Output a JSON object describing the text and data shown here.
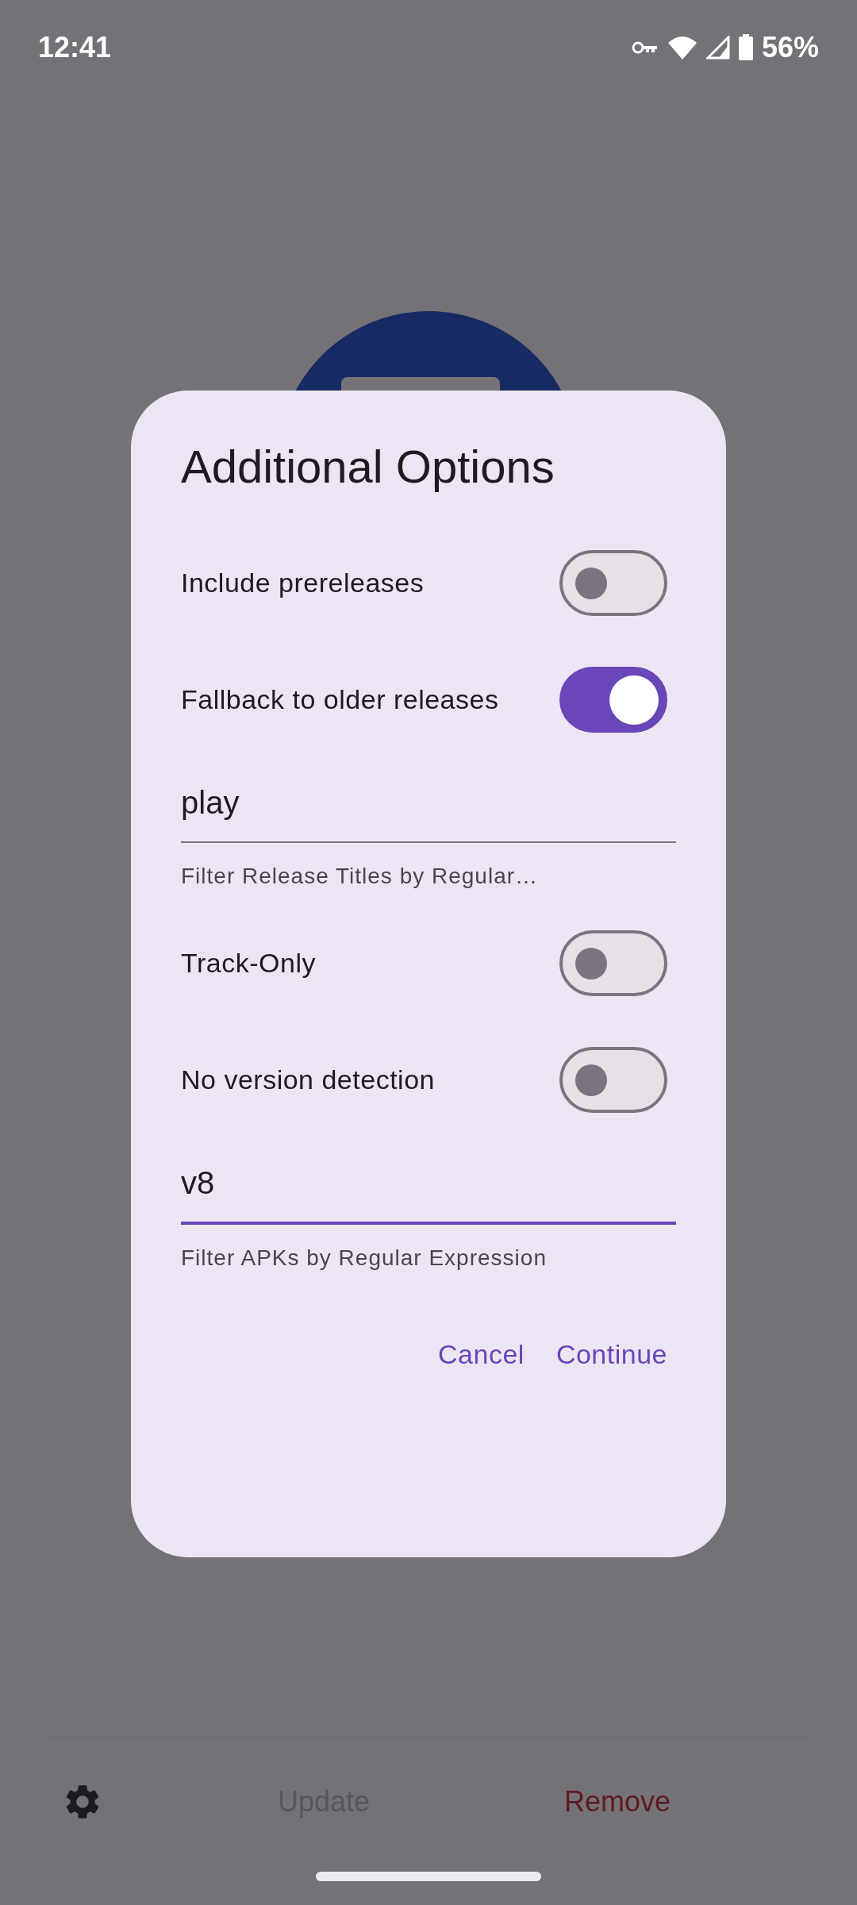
{
  "status_bar": {
    "time": "12:41",
    "battery": "56%"
  },
  "dialog": {
    "title": "Additional Options",
    "items": [
      {
        "kind": "switch",
        "label": "Include prereleases",
        "on": false
      },
      {
        "kind": "switch",
        "label": "Fallback to older releases",
        "on": true
      },
      {
        "kind": "field",
        "value": "play",
        "helper": "Filter Release Titles by Regular…",
        "focused": false
      },
      {
        "kind": "switch",
        "label": "Track-Only",
        "on": false
      },
      {
        "kind": "switch",
        "label": "No version detection",
        "on": false
      },
      {
        "kind": "field",
        "value": "v8",
        "helper": "Filter APKs by Regular Expression",
        "focused": true
      }
    ],
    "buttons": [
      "Cancel",
      "Continue"
    ]
  },
  "bottom_bar": {
    "update": {
      "label": "Update",
      "disabled": true
    },
    "remove": {
      "label": "Remove",
      "disabled": false
    }
  }
}
